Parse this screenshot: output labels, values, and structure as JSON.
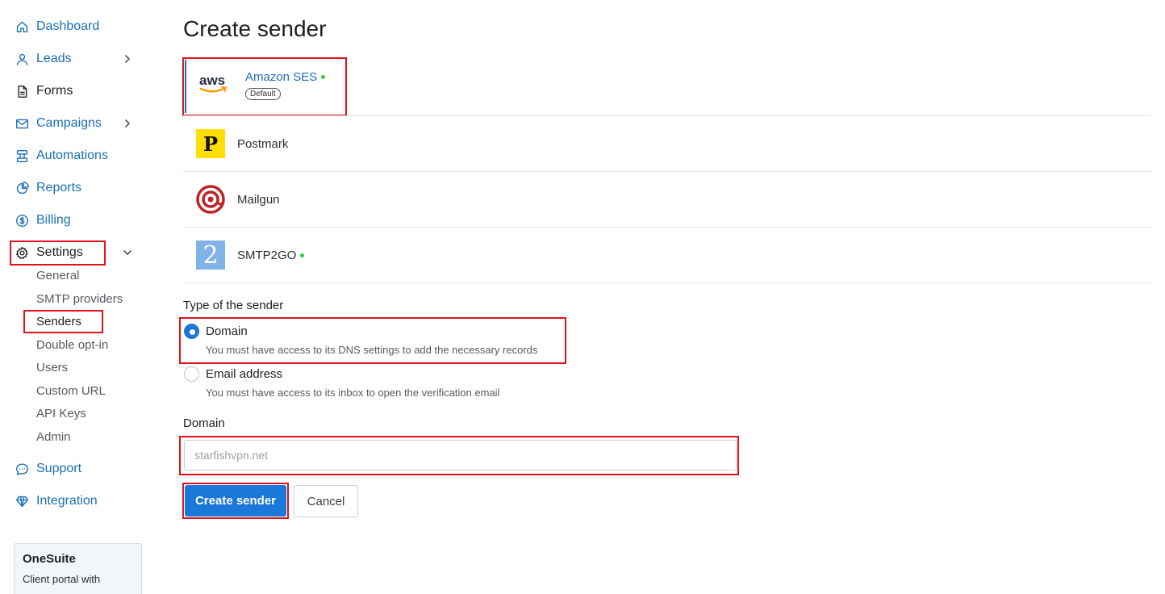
{
  "sidebar": {
    "items": [
      {
        "label": "Dashboard"
      },
      {
        "label": "Leads"
      },
      {
        "label": "Forms"
      },
      {
        "label": "Campaigns"
      },
      {
        "label": "Automations"
      },
      {
        "label": "Reports"
      },
      {
        "label": "Billing"
      },
      {
        "label": "Settings"
      },
      {
        "label": "Support"
      },
      {
        "label": "Integration"
      }
    ],
    "settings_sub": [
      {
        "label": "General"
      },
      {
        "label": "SMTP providers"
      },
      {
        "label": "Senders"
      },
      {
        "label": "Double opt-in"
      },
      {
        "label": "Users"
      },
      {
        "label": "Custom URL"
      },
      {
        "label": "API Keys"
      },
      {
        "label": "Admin"
      }
    ],
    "promo": {
      "title": "OneSuite",
      "text": "Client portal with"
    }
  },
  "main": {
    "title": "Create sender",
    "providers": [
      {
        "name": "Amazon SES",
        "badge": "Default",
        "logo_text": "aws",
        "status_color": "#2ecc40"
      },
      {
        "name": "Postmark",
        "logo_text": "P"
      },
      {
        "name": "Mailgun",
        "logo_text": "@"
      },
      {
        "name": "SMTP2GO",
        "logo_text": "2",
        "status_color": "#2ecc40"
      }
    ],
    "sender_type": {
      "label": "Type of the sender",
      "options": [
        {
          "label": "Domain",
          "help": "You must have access to its DNS settings to add the necessary records",
          "selected": true
        },
        {
          "label": "Email address",
          "help": "You must have access to its inbox to open the verification email",
          "selected": false
        }
      ]
    },
    "domain": {
      "label": "Domain",
      "value": "starfishvpn.net"
    },
    "buttons": {
      "create": "Create sender",
      "cancel": "Cancel"
    }
  },
  "colors": {
    "link": "#1a6fb5",
    "primary": "#1a78d9",
    "highlight": "#e0121b",
    "status": "#2ecc40"
  }
}
